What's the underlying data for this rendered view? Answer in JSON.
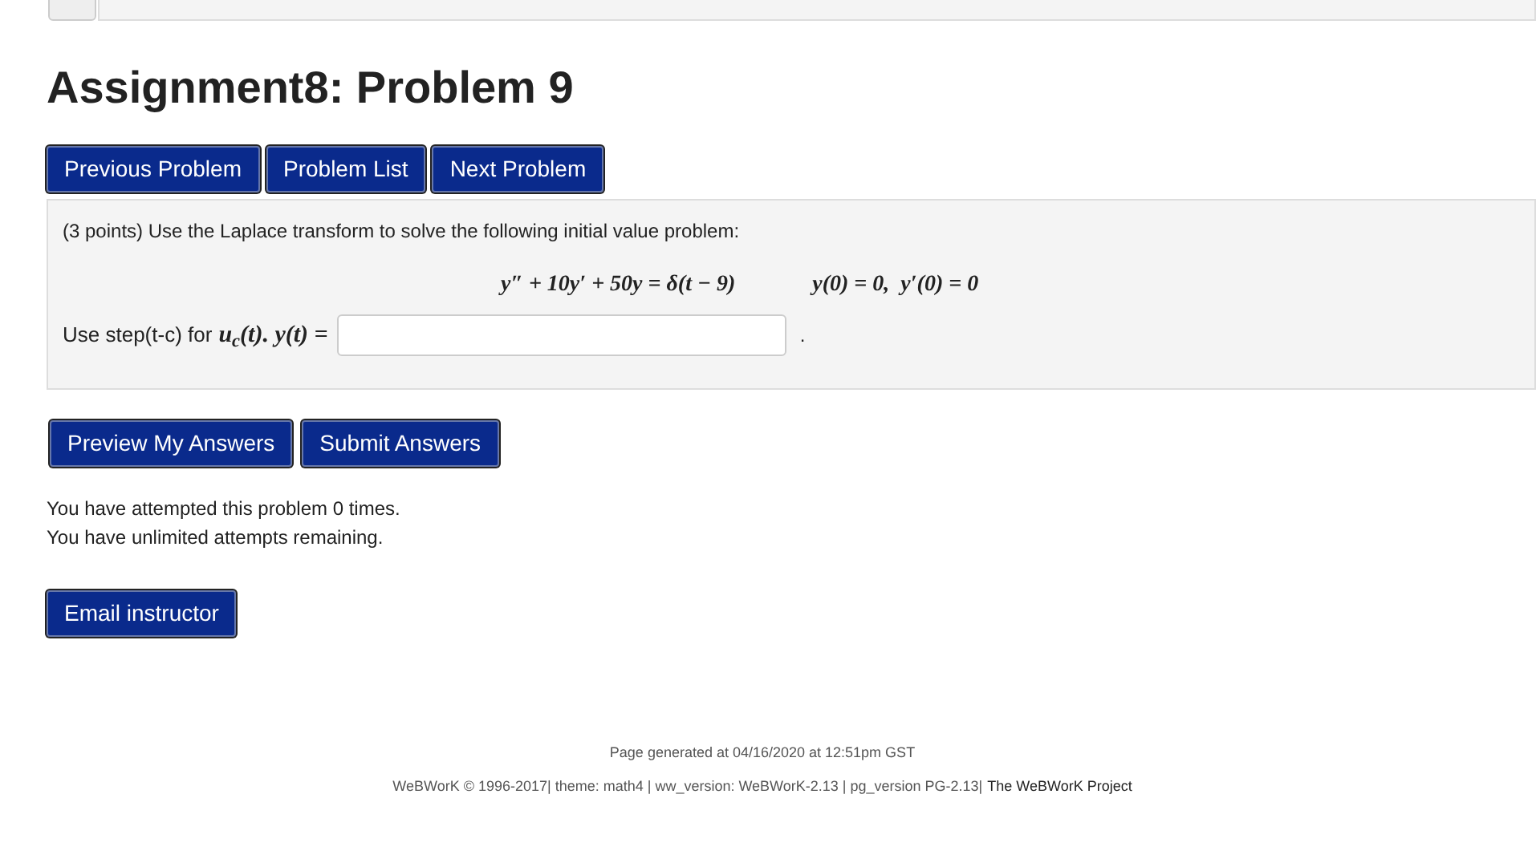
{
  "title": "Assignment8: Problem 9",
  "nav_buttons": [
    "Previous Problem",
    "Problem List",
    "Next Problem"
  ],
  "problem": {
    "statement": "(3 points) Use the Laplace transform to solve the following initial value problem:",
    "equation": "y″ + 10y′ + 50y = δ(t − 9)",
    "initial_conditions": "y(0) = 0,  y′(0) = 0",
    "answer_prompt": "Use step(t-c) for",
    "answer_math": "u$_{c}$(t). y(t) =",
    "answer_trailing": "."
  },
  "answer_buttons": [
    "Preview My Answers",
    "Submit Answers"
  ],
  "attempts": [
    "You have attempted this problem 0 times.",
    "You have unlimited attempts remaining."
  ],
  "email_button": "Email instructor",
  "footer": {
    "generated": "Page generated at 04/16/2020 at 12:51pm GST",
    "credits": "WeBWorK © 1996-2017| theme: math4 | ww_version: WeBWorK-2.13 | pg_version PG-2.13|",
    "project_link": "The WeBWorK Project"
  }
}
